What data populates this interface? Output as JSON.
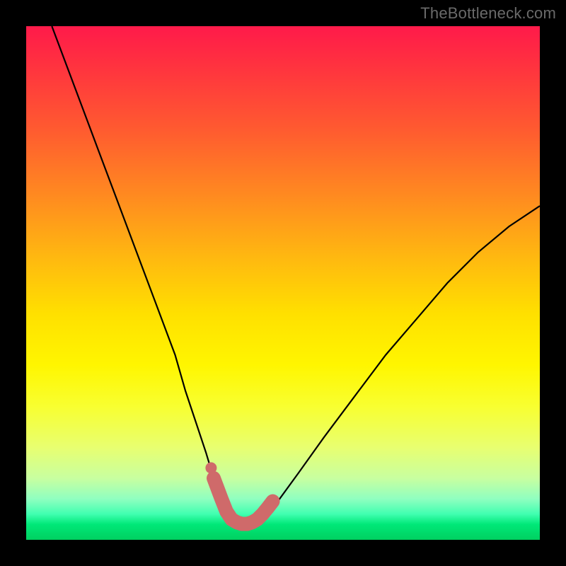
{
  "watermark": "TheBottleneck.com",
  "chart_data": {
    "type": "line",
    "title": "",
    "xlabel": "",
    "ylabel": "",
    "xlim": [
      0,
      100
    ],
    "ylim": [
      0,
      100
    ],
    "series": [
      {
        "name": "bottleneck-curve",
        "x": [
          5,
          8,
          11,
          14,
          17,
          20,
          23,
          26,
          29,
          31,
          33,
          35,
          36.5,
          38,
          39.5,
          41,
          42.5,
          44,
          46,
          49,
          53,
          58,
          64,
          70,
          76,
          82,
          88,
          94,
          100
        ],
        "y": [
          100,
          92,
          84,
          76,
          68,
          60,
          52,
          44,
          36,
          29,
          23,
          17,
          12,
          8,
          5,
          3.5,
          3,
          3.2,
          4.5,
          7.5,
          13,
          20,
          28,
          36,
          43,
          50,
          56,
          61,
          65
        ]
      }
    ],
    "highlight": {
      "name": "bottleneck-min-marker",
      "color": "#cf6a6a",
      "points": [
        {
          "x": 36.5,
          "y": 12
        },
        {
          "x": 38,
          "y": 8
        },
        {
          "x": 39,
          "y": 5.5
        },
        {
          "x": 40,
          "y": 4
        },
        {
          "x": 41,
          "y": 3.4
        },
        {
          "x": 42,
          "y": 3.1
        },
        {
          "x": 43,
          "y": 3.1
        },
        {
          "x": 44,
          "y": 3.4
        },
        {
          "x": 45,
          "y": 4
        },
        {
          "x": 46,
          "y": 5
        },
        {
          "x": 47,
          "y": 6.2
        },
        {
          "x": 48,
          "y": 7.5
        }
      ],
      "dot": {
        "x": 36,
        "y": 14
      }
    },
    "background_gradient": {
      "top": "#ff1a4a",
      "mid": "#fff000",
      "bottom": "#00d060"
    }
  }
}
